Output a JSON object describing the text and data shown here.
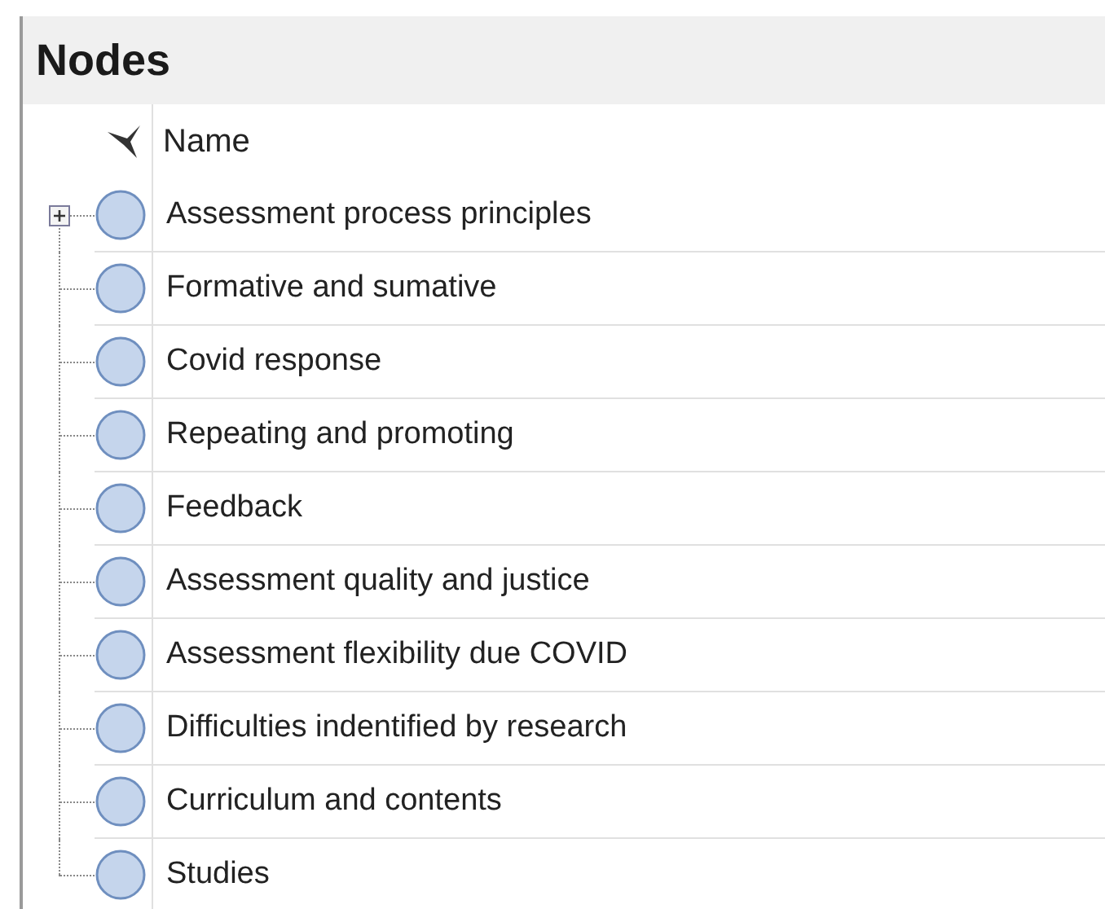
{
  "panel": {
    "title": "Nodes"
  },
  "table": {
    "columns": [
      "Name"
    ],
    "rows": [
      {
        "name": "Assessment process principles",
        "expandable": true
      },
      {
        "name": "Formative and sumative",
        "expandable": false
      },
      {
        "name": "Covid response",
        "expandable": false
      },
      {
        "name": "Repeating and promoting",
        "expandable": false
      },
      {
        "name": "Feedback",
        "expandable": false
      },
      {
        "name": "Assessment quality and justice",
        "expandable": false
      },
      {
        "name": "Assessment flexibility due COVID",
        "expandable": false
      },
      {
        "name": "Difficulties indentified by research",
        "expandable": false
      },
      {
        "name": "Curriculum and contents",
        "expandable": false
      },
      {
        "name": "Studies",
        "expandable": false
      }
    ]
  }
}
